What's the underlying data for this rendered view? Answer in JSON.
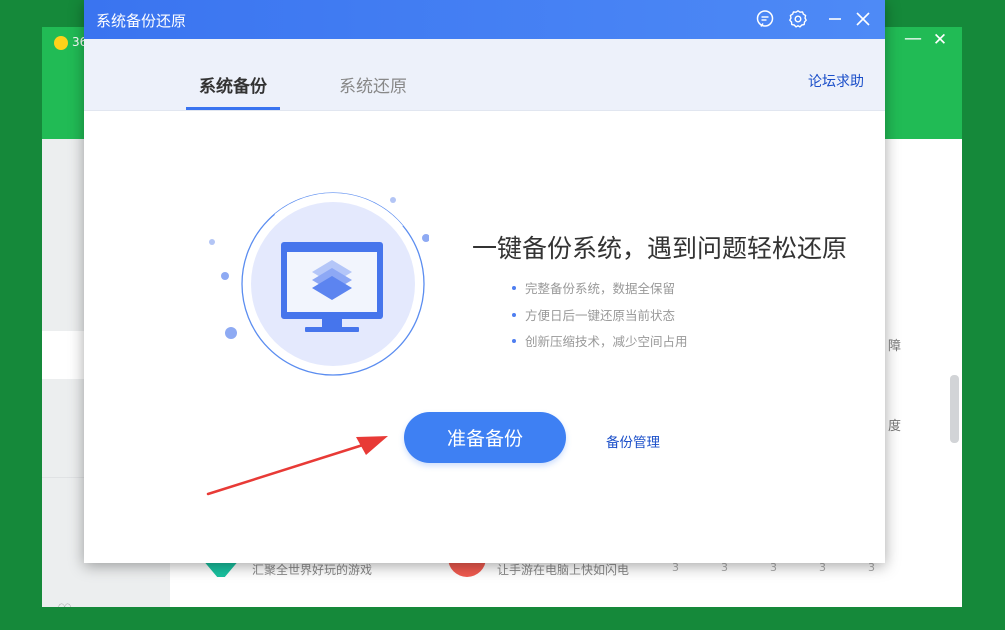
{
  "background_window": {
    "logo_text": "36",
    "window_controls": {
      "minimize": "—",
      "close": "✕"
    },
    "right_truncated_texts": [
      "障",
      "度"
    ],
    "bottom_items": [
      {
        "text": "汇聚全世界好玩的游戏"
      },
      {
        "text": "让手游在电脑上快如闪电"
      }
    ],
    "bottom_dots": "33333"
  },
  "dialog": {
    "title": "系统备份还原",
    "titlebar_icons": [
      "chat-icon",
      "gear-icon",
      "minimize-icon",
      "close-icon"
    ],
    "tabs": [
      {
        "label": "系统备份",
        "active": true
      },
      {
        "label": "系统还原",
        "active": false
      }
    ],
    "help_link": "论坛求助",
    "headline": "一键备份系统，遇到问题轻松还原",
    "features": [
      "完整备份系统，数据全保留",
      "方便日后一键还原当前状态",
      "创新压缩技术，减少空间占用"
    ],
    "primary_button": "准备备份",
    "manage_link": "备份管理"
  },
  "colors": {
    "accent": "#3e80f3",
    "titlebar": "#3a74f0",
    "link": "#1b4fc9",
    "bg_app_header": "#21bb55",
    "desktop": "#15893a",
    "annotation_arrow": "#e83a36"
  }
}
